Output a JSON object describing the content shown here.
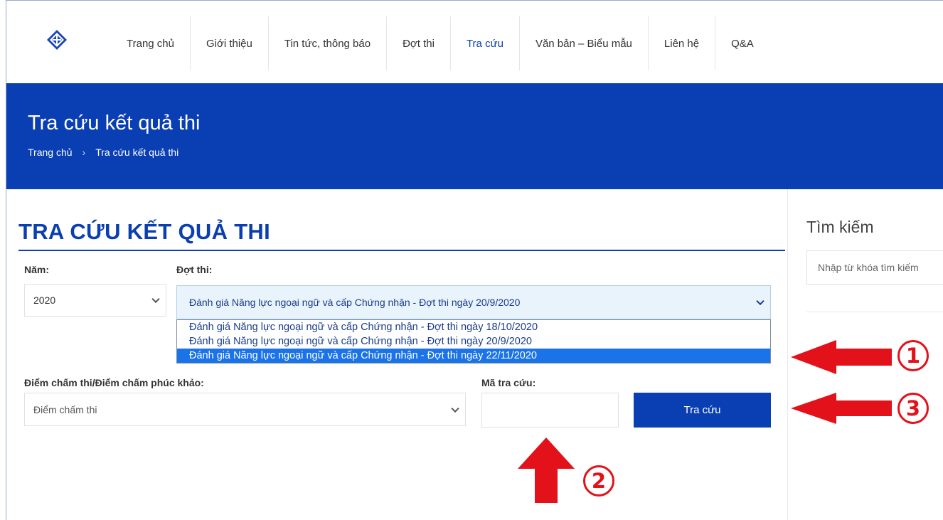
{
  "nav": {
    "logo": "site-logo-icon",
    "items": [
      {
        "label": "Trang chủ"
      },
      {
        "label": "Giới thiệu"
      },
      {
        "label": "Tin tức, thông báo"
      },
      {
        "label": "Đợt thi"
      },
      {
        "label": "Tra cứu"
      },
      {
        "label": "Văn bản – Biểu mẫu"
      },
      {
        "label": "Liên hệ"
      },
      {
        "label": "Q&A"
      }
    ],
    "active_index": 4
  },
  "hero": {
    "title": "Tra cứu kết quả thi",
    "breadcrumb": {
      "home": "Trang chủ",
      "separator": "›",
      "current": "Tra cứu kết quả thi"
    }
  },
  "main": {
    "section_title": "TRA CỨU KẾT QUẢ THI",
    "year": {
      "label": "Năm:",
      "value": "2020"
    },
    "exam": {
      "label": "Đợt thi:",
      "value": "Đánh giá Năng lực ngoại ngữ và cấp Chứng nhận - Đợt thi ngày 20/9/2020",
      "options": [
        "Đánh giá Năng lực ngoại ngữ và cấp Chứng nhận - Đợt thi ngày 18/10/2020",
        "Đánh giá Năng lực ngoại ngữ và cấp Chứng nhận - Đợt thi ngày 20/9/2020",
        "Đánh giá Năng lực ngoại ngữ và cấp Chứng nhận - Đợt thi ngày 22/11/2020"
      ],
      "highlighted_index": 2
    },
    "score_type": {
      "label": "Điểm chấm thi/Điểm chấm phúc khảo:",
      "value": "Điểm chấm thi"
    },
    "code": {
      "label": "Mã tra cứu:",
      "value": ""
    },
    "submit_label": "Tra cứu"
  },
  "sidebar": {
    "search_title": "Tìm kiếm",
    "search_placeholder": "Nhập từ khóa tìm kiếm"
  },
  "annotations": {
    "marker_1": "1",
    "marker_2": "2",
    "marker_3": "3",
    "color": "#e3111a"
  },
  "colors": {
    "brand_blue": "#0a3fb3",
    "highlight": "#1a73e8"
  }
}
